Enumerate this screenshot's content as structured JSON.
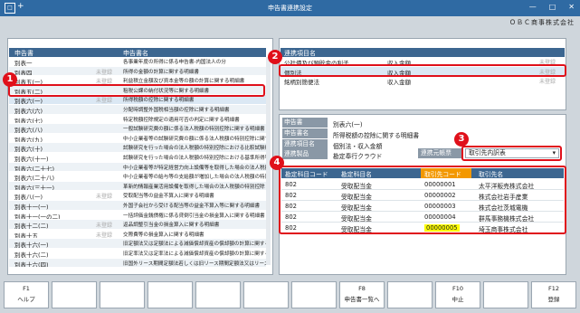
{
  "window": {
    "title": "申告書連携設定",
    "company": "ＯＢＣ商事株式会社",
    "plus": "+",
    "minimize": "—",
    "maximize": "□",
    "close": "✕",
    "app_icon": "□"
  },
  "left_list": {
    "headers": [
      "申告書",
      "申告書名"
    ],
    "rows": [
      {
        "code": "別表一",
        "tag": "",
        "name": "各事業年度の所得に係る申告書-内国法人の分"
      },
      {
        "code": "別表四",
        "tag": "未登録",
        "name": "所得の金額の計算に関する明細書"
      },
      {
        "code": "別表五(一)",
        "tag": "未登録",
        "name": "利益積立金額及び資本金等の額の計算に関する明細書"
      },
      {
        "code": "別表五(二)",
        "tag": "",
        "name": "租税公課の納付状況等に関する明細書"
      },
      {
        "code": "別表六(一)",
        "tag": "未登録",
        "name": "所得税額の控除に関する明細書"
      },
      {
        "code": "別表六(六)",
        "tag": "",
        "name": "分配時調整外国税相当額の控除に関する明細書"
      },
      {
        "code": "別表六(七)",
        "tag": "",
        "name": "特定税額控除規定の適用可否の判定に関する明細書"
      },
      {
        "code": "別表六(八)",
        "tag": "",
        "name": "一般試験研究費の額に係る法人税額の特別控除に関する明細書"
      },
      {
        "code": "別表六(九)",
        "tag": "",
        "name": "中小企業者等の試験研究費の額に係る法人税額の特別控除に関する明細書"
      },
      {
        "code": "別表六(十)",
        "tag": "",
        "name": "試験研究を行った場合の法人税額の特別控除における比較試験研究費の額"
      },
      {
        "code": "別表六(十一)",
        "tag": "",
        "name": "試験研究を行った場合の法人税額の特別控除における基準所得等金額"
      },
      {
        "code": "別表六(二十七)",
        "tag": "",
        "name": "中小企業者等が特定経営力向上設備等を取得した場合の法人税額"
      },
      {
        "code": "別表六(二十八)",
        "tag": "",
        "name": "中小企業者等の給与等の支給額が増加した場合の法人税額の特別控除"
      },
      {
        "code": "別表六(三十一)",
        "tag": "",
        "name": "革新的情報産業活用設備を取得した場合の法人税額の特別控除"
      },
      {
        "code": "別表八(一)",
        "tag": "未登録",
        "name": "受取配当等の益金不算入に関する明細書"
      },
      {
        "code": "別表十一(一)",
        "tag": "",
        "name": "外国子会社から受ける配当等の益金不算入等に関する明細書"
      },
      {
        "code": "別表十一(一の二)",
        "tag": "",
        "name": "一括評価金銭債権に係る貸倒引当金の損金算入に関する明細書"
      },
      {
        "code": "別表十二(二)",
        "tag": "未登録",
        "name": "返品調整引当金の損金算入に関する明細書"
      },
      {
        "code": "別表十五",
        "tag": "未登録",
        "name": "交際費等の損金算入に関する明細書"
      },
      {
        "code": "別表十六(一)",
        "tag": "",
        "name": "旧定額法又は定額法による減価償却資産の償却額の計算に関する明細書"
      },
      {
        "code": "別表十六(二)",
        "tag": "",
        "name": "旧定率法又は定率法による減価償却資産の償却額の計算に関する明細書"
      },
      {
        "code": "別表十六(四)",
        "tag": "",
        "name": "旧国外リース期間定額法若しくは旧リース期間定額法又はリース"
      }
    ]
  },
  "right_list": {
    "header": "連携項目名",
    "rows": [
      {
        "name": "公社債及び預貯金の利子",
        "item": "収入金額",
        "tag": "未登録"
      },
      {
        "name": "個別法",
        "item": "収入金額",
        "tag": "未登録"
      },
      {
        "name": "銘柄別簡便法",
        "item": "収入金額",
        "tag": "未登録"
      }
    ]
  },
  "info": {
    "rows": [
      {
        "label": "申告書",
        "value": "別表六(一)"
      },
      {
        "label": "申告書名",
        "value": "所得税額の控除に関する明細書"
      },
      {
        "label": "連携項目名",
        "value": "個別法・収入金額"
      },
      {
        "label": "連携製品",
        "value": "勘定奉行クラウド"
      }
    ],
    "source_label": "連携元帳票",
    "source_value": "取引先内訳表"
  },
  "table": {
    "headers": [
      "勘定科目コード",
      "勘定科目名",
      "取引先コード",
      "取引先名"
    ],
    "rows": [
      [
        "802",
        "受取配当金",
        "00000001",
        "太平洋販売株式会社"
      ],
      [
        "802",
        "受取配当金",
        "00000002",
        "株式会社岩手産業"
      ],
      [
        "802",
        "受取配当金",
        "00000003",
        "株式会社茨城電機"
      ],
      [
        "802",
        "受取配当金",
        "00000004",
        "群馬事務機株式会社"
      ],
      [
        "802",
        "受取配当金",
        "00000005",
        "埼玉商事株式会社"
      ]
    ]
  },
  "badges": [
    "1",
    "2",
    "3",
    "4"
  ],
  "footer": {
    "keys": [
      {
        "key": "F1",
        "label": "ヘルプ"
      },
      {
        "key": "",
        "label": ""
      },
      {
        "key": "",
        "label": ""
      },
      {
        "key": "",
        "label": ""
      },
      {
        "key": "",
        "label": ""
      },
      {
        "key": "",
        "label": ""
      },
      {
        "key": "",
        "label": ""
      },
      {
        "key": "F8",
        "label": "申告書一覧へ"
      },
      {
        "key": "",
        "label": ""
      },
      {
        "key": "F10",
        "label": "中止"
      },
      {
        "key": "",
        "label": ""
      },
      {
        "key": "F12",
        "label": "登録"
      }
    ]
  }
}
